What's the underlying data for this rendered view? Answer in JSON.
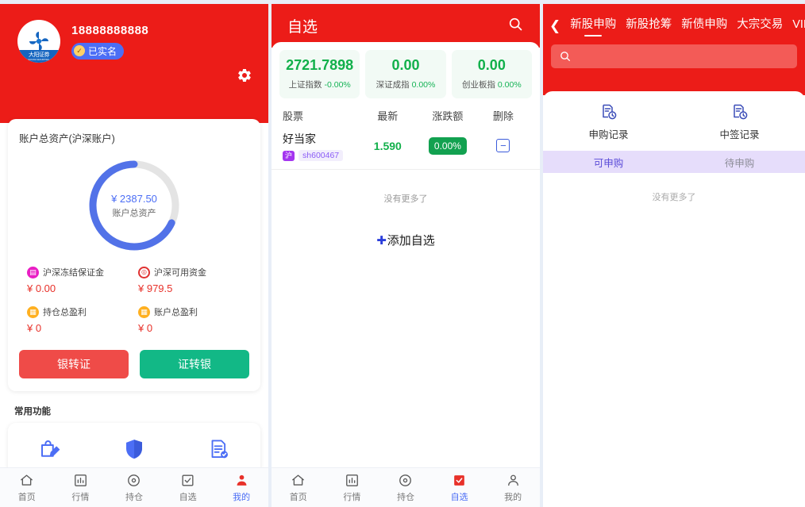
{
  "panel_account": {
    "header": {
      "phone": "18888888888",
      "verified_badge": "已实名",
      "logo_text": "大阳证券",
      "logo_sub": "DAYANG SECURITIES",
      "settings_icon": "gear-icon"
    },
    "asset_card": {
      "title": "账户总资产(沪深账户)",
      "donut": {
        "currency": "¥",
        "amount": "2387.50",
        "label": "账户总资产",
        "percent": 68,
        "arc_color": "#5272e8",
        "track_color": "#e2e2e2"
      },
      "stats": [
        {
          "icon": "frozen-margin-icon",
          "name": "沪深冻结保证金",
          "value": "¥ 0.00",
          "color": "#e91ec4"
        },
        {
          "icon": "available-funds-icon",
          "name": "沪深可用资金",
          "value": "¥ 979.5",
          "color": "#e03131"
        },
        {
          "icon": "position-profit-icon",
          "name": "持仓总盈利",
          "value": "¥ 0",
          "color": "#ffb020"
        },
        {
          "icon": "account-profit-icon",
          "name": "账户总盈利",
          "value": "¥ 0",
          "color": "#ffb020"
        }
      ],
      "buttons": {
        "bank_to_broker": "银转证",
        "broker_to_bank": "证转银"
      }
    },
    "common_functions": {
      "label": "常用功能",
      "items": [
        {
          "icon": "bag-edit-icon"
        },
        {
          "icon": "shield-icon"
        },
        {
          "icon": "clipboard-check-icon"
        }
      ]
    },
    "tabbar": [
      {
        "label": "首页",
        "icon": "home-icon",
        "active": false
      },
      {
        "label": "行情",
        "icon": "chart-icon",
        "active": false
      },
      {
        "label": "持仓",
        "icon": "position-icon",
        "active": false
      },
      {
        "label": "自选",
        "icon": "check-box-icon",
        "active": false
      },
      {
        "label": "我的",
        "icon": "user-icon",
        "active": true
      }
    ]
  },
  "panel_watchlist": {
    "header": {
      "title": "自选",
      "search_icon": "search-icon"
    },
    "indices": [
      {
        "value": "2721.7898",
        "name": "上证指数",
        "change": "-0.00%"
      },
      {
        "value": "0.00",
        "name": "深证成指",
        "change": "0.00%"
      },
      {
        "value": "0.00",
        "name": "创业板指",
        "change": "0.00%"
      }
    ],
    "columns": [
      "股票",
      "最新",
      "涨跌额",
      "删除"
    ],
    "rows": [
      {
        "name": "好当家",
        "market": "沪",
        "code": "sh600467",
        "last": "1.590",
        "change_pct": "0.00%",
        "delete_icon": "minus-box-icon"
      }
    ],
    "empty_text": "没有更多了",
    "add_button": {
      "plus": "✚",
      "label": "添加自选"
    },
    "tabbar": [
      {
        "label": "首页",
        "icon": "home-icon",
        "active": false
      },
      {
        "label": "行情",
        "icon": "chart-icon",
        "active": false
      },
      {
        "label": "持仓",
        "icon": "position-icon",
        "active": false
      },
      {
        "label": "自选",
        "icon": "check-box-icon",
        "active": true
      },
      {
        "label": "我的",
        "icon": "user-icon",
        "active": false
      }
    ]
  },
  "panel_ipo": {
    "back_icon": "chevron-left-icon",
    "tabs": [
      {
        "label": "新股申购",
        "selected": true
      },
      {
        "label": "新股抢筹",
        "selected": false
      },
      {
        "label": "新债申购",
        "selected": false
      },
      {
        "label": "大宗交易",
        "selected": false
      },
      {
        "label": "VIP抢筹",
        "selected": false
      }
    ],
    "search": {
      "icon": "search-icon",
      "placeholder": ""
    },
    "records": [
      {
        "icon": "record-clock-icon",
        "label": "申购记录"
      },
      {
        "icon": "record-clock-icon",
        "label": "中签记录"
      }
    ],
    "sub_tabs": [
      {
        "label": "可申购",
        "selected": true
      },
      {
        "label": "待申购",
        "selected": false
      }
    ],
    "empty_text": "没有更多了"
  },
  "theme": {
    "brand_red": "#ec1c18",
    "accent_blue": "#4c6ef5",
    "up_green": "#12b04b",
    "down_red": "#e8312a",
    "page_bg": "#e8eef7"
  }
}
